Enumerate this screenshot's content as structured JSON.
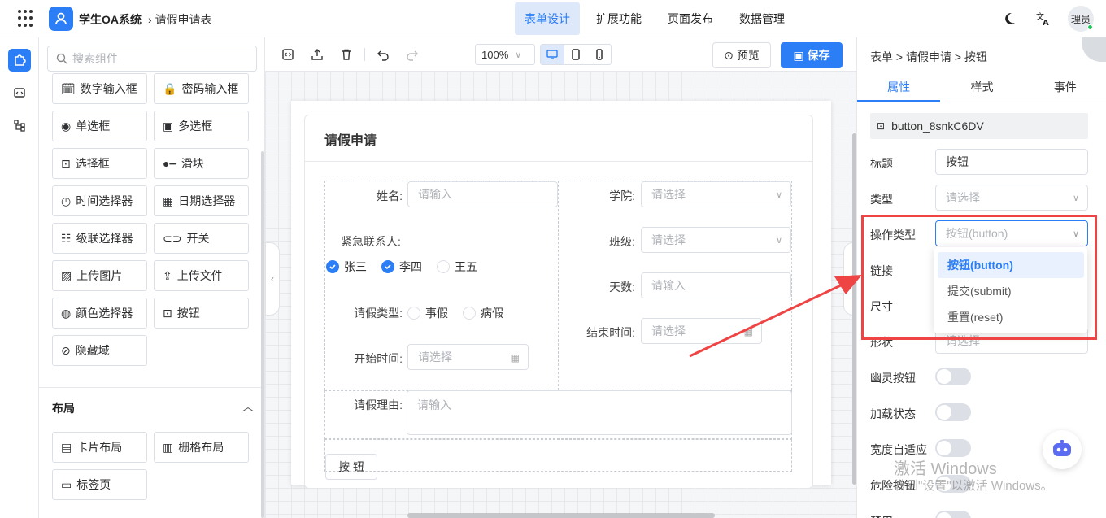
{
  "topbar": {
    "app_title": "学生OA系统",
    "breadcrumb": "请假申请表",
    "nav_tabs": [
      "表单设计",
      "扩展功能",
      "页面发布",
      "数据管理"
    ],
    "active_tab": "表单设计",
    "user": "理员"
  },
  "library": {
    "search_placeholder": "搜索组件",
    "components": [
      "数字输入框",
      "密码输入框",
      "单选框",
      "多选框",
      "选择框",
      "滑块",
      "时间选择器",
      "日期选择器",
      "级联选择器",
      "开关",
      "上传图片",
      "上传文件",
      "颜色选择器",
      "按钮",
      "隐藏域"
    ],
    "layout_section_title": "布局",
    "layouts": [
      "卡片布局",
      "栅格布局",
      "标签页"
    ]
  },
  "toolbar": {
    "zoom": "100%",
    "preview_label": "预览",
    "save_label": "保存"
  },
  "form": {
    "title": "请假申请",
    "name_label": "姓名:",
    "name_placeholder": "请输入",
    "contact_label": "紧急联系人:",
    "contacts": [
      {
        "label": "张三",
        "checked": true
      },
      {
        "label": "李四",
        "checked": true
      },
      {
        "label": "王五",
        "checked": false
      }
    ],
    "leave_type_label": "请假类型:",
    "leave_types": [
      "事假",
      "病假"
    ],
    "start_time_label": "开始时间:",
    "start_time_placeholder": "请选择",
    "college_label": "学院:",
    "college_placeholder": "请选择",
    "class_label": "班级:",
    "class_placeholder": "请选择",
    "days_label": "天数:",
    "days_placeholder": "请输入",
    "end_time_label": "结束时间:",
    "end_time_placeholder": "请选择",
    "reason_label": "请假理由:",
    "reason_placeholder": "请输入",
    "button_label": "按 钮"
  },
  "props": {
    "breadcrumb": "表单 > 请假申请 > 按钮",
    "tabs": [
      "属性",
      "样式",
      "事件"
    ],
    "active_tab": "属性",
    "component_id": "button_8snkC6DV",
    "title_label": "标题",
    "title_value": "按钮",
    "type_label": "类型",
    "type_placeholder": "请选择",
    "action_type_label": "操作类型",
    "action_type_placeholder": "按钮(button)",
    "link_label": "链接",
    "size_label": "尺寸",
    "shape_label": "形状",
    "shape_placeholder": "请选择",
    "ghost_label": "幽灵按钮",
    "loading_label": "加载状态",
    "block_label": "宽度自适应",
    "danger_label": "危险按钮",
    "disabled_label": "禁用",
    "action_type_options": [
      "按钮(button)",
      "提交(submit)",
      "重置(reset)"
    ],
    "selected_option": "按钮(button)"
  },
  "watermark": {
    "line1": "激活 Windows",
    "line2": "转到\"设置\"以激活 Windows。"
  },
  "colors": {
    "accent": "#2b7ef6",
    "annotation": "#ef4444"
  }
}
